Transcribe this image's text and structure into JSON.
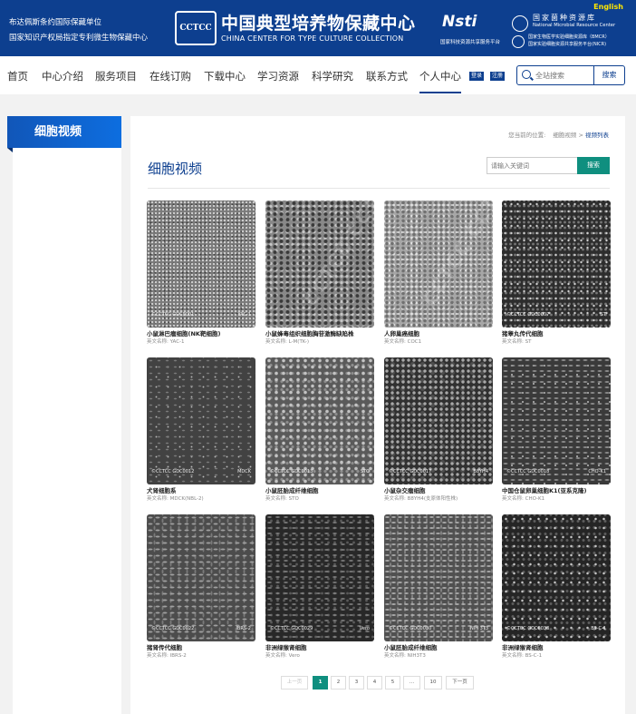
{
  "header": {
    "english_link": "English",
    "tagline_1": "布达佩斯条约国际保藏单位",
    "tagline_2": "国家知识产权局指定专利微生物保藏中心",
    "logo_mark": "CCTCC",
    "logo_cn": "中国典型培养物保藏中心",
    "logo_en": "CHINA CENTER FOR TYPE CULTURE COLLECTION",
    "nsti_mark": "Nsti",
    "nsti_sub": "国家科技资源共享服务平台",
    "nmrc_line1": "国家菌种资源库",
    "nmrc_line2": "National Microbial Resource Center",
    "nmrc_line3": "国家生物医学实验细胞资源库（BMCR）",
    "nmrc_line4": "国家实验细胞资源共享服务平台(NICR)"
  },
  "nav": {
    "items": [
      "首页",
      "中心介绍",
      "服务项目",
      "在线订购",
      "下载中心",
      "学习资源",
      "科学研究",
      "联系方式",
      "个人中心"
    ],
    "active_index": 8,
    "login": "登录",
    "register": "注册",
    "search_placeholder": "全站搜索",
    "search_button": "搜索"
  },
  "sidebar": {
    "title": "细胞视频"
  },
  "breadcrumb": {
    "prefix": "您当前的位置:",
    "level1": "细胞视频",
    "sep": ">",
    "current": "视频列表"
  },
  "main": {
    "title": "细胞视频",
    "keyword_placeholder": "请输入关键词",
    "search_button": "搜索"
  },
  "video_cards": [
    {
      "name": "小鼠淋巴瘤细胞(NK靶细胞)",
      "en_label": "英文名称:",
      "en": "YAC-1",
      "tag_left": "©CCTCC GDC0001",
      "tag_right": "YAC-1"
    },
    {
      "name": "小鼠蜂毒组织细胞胸苷激酶缺陷株",
      "en_label": "英文名称:",
      "en": "L-M(TK-)",
      "tag_left": "",
      "tag_right": "",
      "watermark": "CCTCC CCTCC"
    },
    {
      "name": "人卵巢癌细胞",
      "en_label": "英文名称:",
      "en": "COC1",
      "tag_left": "",
      "tag_right": "",
      "watermark": "CCTCC CCTCC"
    },
    {
      "name": "猪睾丸传代细胞",
      "en_label": "英文名称:",
      "en": "ST",
      "tag_left": "©CCTCC GDC0007",
      "tag_right": "ST"
    },
    {
      "name": "犬肾细胞系",
      "en_label": "英文名称:",
      "en": "MDCK(NBL-2)",
      "tag_left": "©CCTCC GDC0012",
      "tag_right": "MDCK"
    },
    {
      "name": "小鼠胚胎成纤维细胞",
      "en_label": "英文名称:",
      "en": "STO",
      "tag_left": "©CCTCC GDC0013",
      "tag_right": "STO"
    },
    {
      "name": "小鼠杂交瘤细胞",
      "en_label": "英文名称:",
      "en": "B8YH4(支原体阳性株)",
      "tag_left": "©CCTCC GDC0017",
      "tag_right": "B8YH4"
    },
    {
      "name": "中国仓鼠卵巢细胞K1(亚系克隆)",
      "en_label": "英文名称:",
      "en": "CHO-K1",
      "tag_left": "©CCTCC GDC0018",
      "tag_right": "CHO-K1"
    },
    {
      "name": "猪肾传代细胞",
      "en_label": "英文名称:",
      "en": "IBRS-2",
      "tag_left": "©CCTCC GDC0022",
      "tag_right": "IBRS-2"
    },
    {
      "name": "非洲绿猴肾细胞",
      "en_label": "英文名称:",
      "en": "Vero",
      "tag_left": "©CCTCC GDC0029",
      "tag_right": "Vero"
    },
    {
      "name": "小鼠胚胎成纤维细胞",
      "en_label": "英文名称:",
      "en": "NIH3T3",
      "tag_left": "©CCTCC GDC0030",
      "tag_right": "NIH 3T3"
    },
    {
      "name": "非洲绿猴肾细胞",
      "en_label": "英文名称:",
      "en": "BS-C-1",
      "tag_left": "©CCTCC GDC0033",
      "tag_right": "BS-C-1"
    }
  ],
  "pagination": {
    "prev": "上一页",
    "pages": [
      "1",
      "2",
      "3",
      "4",
      "5",
      "...",
      "10"
    ],
    "current": "1",
    "next": "下一页"
  }
}
